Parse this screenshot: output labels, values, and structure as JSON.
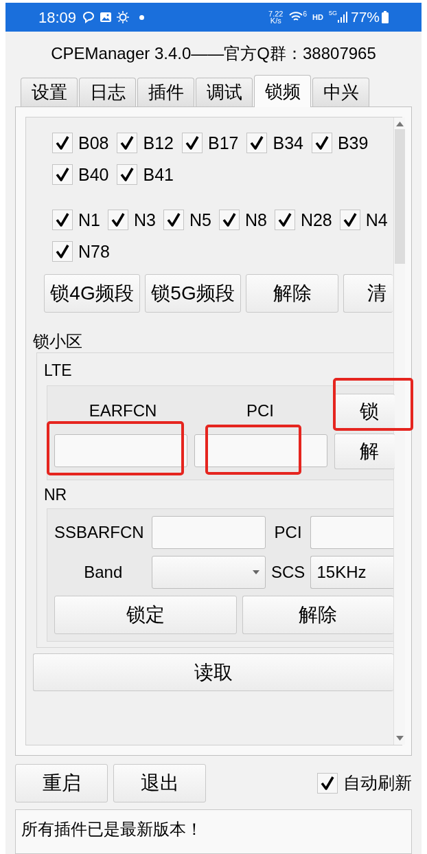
{
  "status_bar": {
    "time": "18:09",
    "speed": "7.22",
    "speed_unit": "K/s",
    "wifi_badge": "6",
    "hd": "HD",
    "network": "5G",
    "battery": "77%"
  },
  "title": "CPEManager 3.4.0——官方Q群：38807965",
  "tabs": [
    {
      "label": "设置",
      "selected": false
    },
    {
      "label": "日志",
      "selected": false
    },
    {
      "label": "插件",
      "selected": false
    },
    {
      "label": "调试",
      "selected": false
    },
    {
      "label": "锁频",
      "selected": true
    },
    {
      "label": "中兴",
      "selected": false
    }
  ],
  "lte_bands": [
    {
      "label": "B08",
      "checked": true
    },
    {
      "label": "B12",
      "checked": true
    },
    {
      "label": "B17",
      "checked": true
    },
    {
      "label": "B34",
      "checked": true
    },
    {
      "label": "B39",
      "checked": true
    },
    {
      "label": "B40",
      "checked": true
    },
    {
      "label": "B41",
      "checked": true
    }
  ],
  "nr_bands": [
    {
      "label": "N1",
      "checked": true
    },
    {
      "label": "N3",
      "checked": true
    },
    {
      "label": "N5",
      "checked": true
    },
    {
      "label": "N8",
      "checked": true
    },
    {
      "label": "N28",
      "checked": true
    },
    {
      "label": "N4",
      "checked": true
    },
    {
      "label": "N78",
      "checked": true
    }
  ],
  "band_buttons": [
    "锁4G频段",
    "锁5G频段",
    "解除",
    "清"
  ],
  "cell_lock": {
    "title": "锁小区",
    "lte": {
      "title": "LTE",
      "earfcn": {
        "label": "EARFCN",
        "highlighted": true
      },
      "pci": {
        "label": "PCI",
        "highlighted": true
      },
      "lock_button": {
        "label": "锁",
        "highlighted": true
      },
      "unlock_button": {
        "label": "解"
      }
    },
    "nr": {
      "title": "NR",
      "ssbarfcn_label": "SSBARFCN",
      "pci_label": "PCI",
      "band_label": "Band",
      "scs_label": "SCS",
      "scs_value": "15KHz",
      "buttons": [
        "锁定",
        "解除"
      ]
    }
  },
  "read_button": "读取",
  "bottom_buttons": [
    "重启",
    "退出"
  ],
  "auto_refresh": {
    "label": "自动刷新",
    "checked": true
  },
  "message": "所有插件已是最新版本！"
}
